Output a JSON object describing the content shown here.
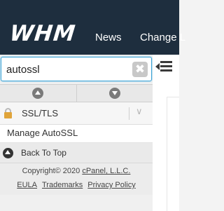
{
  "header": {
    "logo": "WHM",
    "nav": [
      "News",
      "Change L"
    ]
  },
  "search": {
    "value": "autossl",
    "clear_icon": "clear-x-icon"
  },
  "sidebar": {
    "category": {
      "icon": "lock-icon",
      "label": "SSL/TLS",
      "toggle_icon": "chevron-down-icon"
    },
    "items": [
      {
        "label": "Manage AutoSSL"
      }
    ],
    "back_to_top": "Back To Top"
  },
  "footer": {
    "copyright_prefix": "Copyright© 2020 ",
    "company": "cPanel, L.L.C.",
    "links": [
      "EULA",
      "Trademarks",
      "Privacy Policy"
    ]
  },
  "colors": {
    "header_bg": "#1e2e3e",
    "search_focus": "#3aa3d6",
    "lock": "#e0a43a"
  }
}
